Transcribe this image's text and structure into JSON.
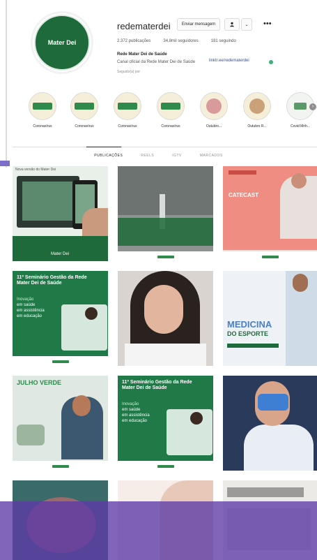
{
  "profile": {
    "username": "redematerdei",
    "avatar_logo": "Mater Dei",
    "message_label": "Enviar mensagem",
    "follow_icon": "follow-icon",
    "caret": "⌄",
    "more": "•••",
    "stats": [
      "2.372 publicações",
      "34,8mil seguidores",
      "181 seguindo"
    ],
    "full_name": "Rede Mater Dei de Saúde",
    "bio": "Canal oficial da Rede Mater Dei de Saúde",
    "link": "linktr.ee/redematerdei",
    "followed_by": "Seguido(a) por"
  },
  "highlights": [
    {
      "label": "Coronavírus",
      "icon": "highlight-green"
    },
    {
      "label": "Coronavírus",
      "icon": "highlight-green"
    },
    {
      "label": "Coronavírus",
      "icon": "highlight-green"
    },
    {
      "label": "Coronavírus",
      "icon": "highlight-green"
    },
    {
      "label": "Outubro...",
      "icon": "highlight-photo"
    },
    {
      "label": "Outubro R...",
      "icon": "highlight-photo"
    },
    {
      "label": "Covid Mnh...",
      "icon": "highlight-white"
    }
  ],
  "tabs": [
    "PUBLICAÇÕES",
    "REELS",
    "IGTV",
    "MARCADOS"
  ],
  "posts": {
    "p1_header": "Nova versão do Mater Dei",
    "p4_title": "11º Seminário Gestão da Rede Mater Dei de Saúde",
    "p4_lines": [
      "Inovação",
      "em saúde",
      "em assistência",
      "em educação"
    ],
    "p6_title": "MEDICINA",
    "p6_sub": "DO ESPORTE",
    "p7_title": "JULHO VERDE",
    "p8_title": "11º Seminário Gestão da Rede Mater Dei de Saúde",
    "p8_lines": [
      "Inovação",
      "em saúde",
      "em assistência",
      "em educação"
    ],
    "p3_title": "CATECAST",
    "brand": "Mater Dei"
  },
  "colors": {
    "brand_green": "#1f6a3a",
    "overlay_purple": "#5c3aa8",
    "link_blue": "#385185"
  }
}
